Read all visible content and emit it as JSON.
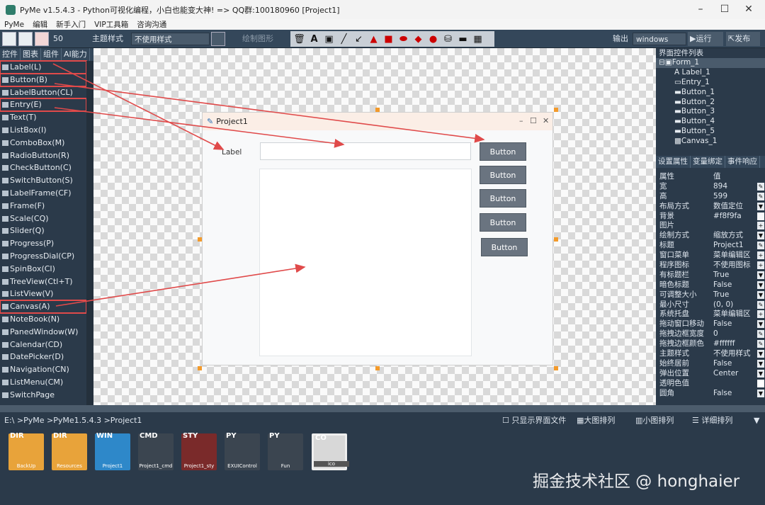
{
  "title": "PyMe v1.5.4.3 - Python可视化编程，小白也能变大神!   => QQ群:100180960    [Project1]",
  "menu": [
    "PyMe",
    "编辑",
    "新手入门",
    "VIP工具箱",
    "咨询沟通"
  ],
  "toolbar": {
    "size": "50",
    "theme_label": "主题样式",
    "theme_value": "不使用样式",
    "draw_label": "绘制图形",
    "output_label": "输出",
    "output_value": "windows",
    "run": "运行",
    "publish": "发布"
  },
  "left_tabs": [
    "控件",
    "图表",
    "组件",
    "AI能力"
  ],
  "widgets": [
    "Label(L)",
    "Button(B)",
    "LabelButton(CL)",
    "Entry(E)",
    "Text(T)",
    "ListBox(I)",
    "ComboBox(M)",
    "RadioButton(R)",
    "CheckButton(C)",
    "SwitchButton(S)",
    "LabelFrame(CF)",
    "Frame(F)",
    "Scale(CQ)",
    "Slider(Q)",
    "Progress(P)",
    "ProgressDial(CP)",
    "SpinBox(CI)",
    "TreeView(Ctl+T)",
    "ListView(V)",
    "Canvas(A)",
    "NoteBook(N)",
    "PanedWindow(W)",
    "Calendar(CD)",
    "DatePicker(D)",
    "Navigation(CN)",
    "ListMenu(CM)",
    "SwitchPage"
  ],
  "form": {
    "title": "Project1",
    "label": "Label",
    "buttons": [
      "Button",
      "Button",
      "Button",
      "Button",
      "Button"
    ]
  },
  "right": {
    "tree_title": "界面控件列表",
    "tree": [
      "Form_1",
      "Label_1",
      "Entry_1",
      "Button_1",
      "Button_2",
      "Button_3",
      "Button_4",
      "Button_5",
      "Canvas_1"
    ],
    "tabs": [
      "设置属性",
      "变量绑定",
      "事件响应"
    ],
    "prop_header": [
      "属性",
      "值"
    ],
    "props": [
      [
        "宽",
        "894"
      ],
      [
        "高",
        "599"
      ],
      [
        "布局方式",
        "数值定位"
      ],
      [
        "背景",
        "#f8f9fa"
      ],
      [
        "图片",
        ""
      ],
      [
        "绘制方式",
        "缩放方式"
      ],
      [
        "标题",
        "Project1"
      ],
      [
        "窗口菜单",
        "菜单编辑区"
      ],
      [
        "程序图标",
        "不使用图标"
      ],
      [
        "有标题栏",
        "True"
      ],
      [
        "暗色标题",
        "False"
      ],
      [
        "可调整大小",
        "True"
      ],
      [
        "最小尺寸",
        "(0, 0)"
      ],
      [
        "系统托盘",
        "菜单编辑区"
      ],
      [
        "拖动窗口移动",
        "False"
      ],
      [
        "拖拽边框宽度",
        "0"
      ],
      [
        "拖拽边框颜色",
        "#ffffff"
      ],
      [
        "主题样式",
        "不使用样式"
      ],
      [
        "始终居前",
        "False"
      ],
      [
        "弹出位置",
        "Center"
      ],
      [
        "透明色值",
        ""
      ],
      [
        "圆角",
        "False"
      ]
    ]
  },
  "path": "E:\\ >PyMe >PyMe1.5.4.3 >Project1",
  "view": {
    "only_ui": "只显示界面文件",
    "large": "大图排列",
    "small": "小图排列",
    "detail": "详细排列"
  },
  "files": [
    {
      "tag": "DIR",
      "name": "BackUp",
      "color": "#e8a33a"
    },
    {
      "tag": "DIR",
      "name": "Resources",
      "color": "#e8a33a"
    },
    {
      "tag": "WIN",
      "name": "Project1",
      "color": "#2e88c9"
    },
    {
      "tag": "CMD",
      "name": "Project1_cmd",
      "color": "#3b4550"
    },
    {
      "tag": "STY",
      "name": "Project1_sty",
      "color": "#7a2a2a"
    },
    {
      "tag": "PY",
      "name": "EXUIControl",
      "color": "#3b4550"
    },
    {
      "tag": "PY",
      "name": "Fun",
      "color": "#3b4550"
    },
    {
      "tag": "CO",
      "name": "ico",
      "color": "#d8d8d8"
    }
  ],
  "watermark": "掘金技术社区 @ honghaier"
}
